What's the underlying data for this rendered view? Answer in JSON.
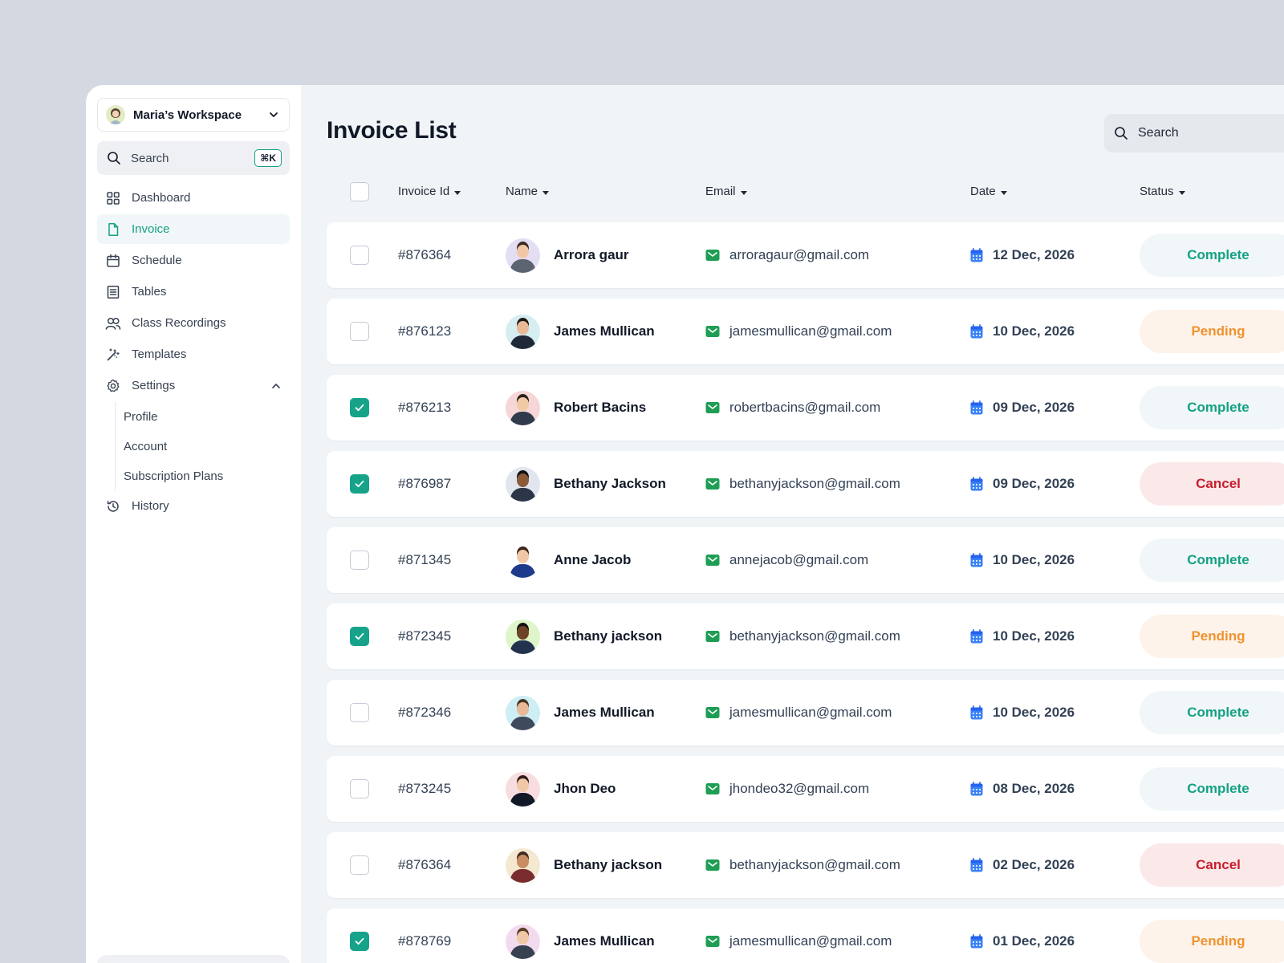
{
  "sidebar": {
    "workspace": "Maria’s Workspace",
    "search_placeholder": "Search",
    "shortcut": "⌘K",
    "items": [
      {
        "label": "Dashboard",
        "icon": "dashboard-icon",
        "active": false
      },
      {
        "label": "Invoice",
        "icon": "document-icon",
        "active": true
      },
      {
        "label": "Schedule",
        "icon": "calendar-icon",
        "active": false
      },
      {
        "label": "Tables",
        "icon": "table-icon",
        "active": false
      },
      {
        "label": "Class Recordings",
        "icon": "users-icon",
        "active": false
      },
      {
        "label": "Templates",
        "icon": "magic-wand-icon",
        "active": false
      },
      {
        "label": "Settings",
        "icon": "gear-icon",
        "active": false
      }
    ],
    "settings_sub": [
      "Profile",
      "Account",
      "Subscription Plans"
    ],
    "history": "History"
  },
  "main": {
    "title": "Invoice List",
    "search_placeholder": "Search",
    "columns": [
      "Invoice Id",
      "Name",
      "Email",
      "Date",
      "Status"
    ],
    "rows": [
      {
        "id": "#876364",
        "name": "Arrora gaur",
        "email": "arroragaur@gmail.com",
        "date": "12 Dec, 2026",
        "status": "Complete",
        "checked": false
      },
      {
        "id": "#876123",
        "name": "James Mullican",
        "email": "jamesmullican@gmail.com",
        "date": "10 Dec, 2026",
        "status": "Pending",
        "checked": false
      },
      {
        "id": "#876213",
        "name": "Robert Bacins",
        "email": "robertbacins@gmail.com",
        "date": "09 Dec, 2026",
        "status": "Complete",
        "checked": true
      },
      {
        "id": "#876987",
        "name": "Bethany Jackson",
        "email": "bethanyjackson@gmail.com",
        "date": "09 Dec, 2026",
        "status": "Cancel",
        "checked": true
      },
      {
        "id": "#871345",
        "name": "Anne Jacob",
        "email": "annejacob@gmail.com",
        "date": "10 Dec, 2026",
        "status": "Complete",
        "checked": false
      },
      {
        "id": "#872345",
        "name": "Bethany jackson",
        "email": "bethanyjackson@gmail.com",
        "date": "10 Dec, 2026",
        "status": "Pending",
        "checked": true
      },
      {
        "id": "#872346",
        "name": "James Mullican",
        "email": "jamesmullican@gmail.com",
        "date": "10 Dec, 2026",
        "status": "Complete",
        "checked": false
      },
      {
        "id": "#873245",
        "name": "Jhon Deo",
        "email": "jhondeo32@gmail.com",
        "date": "08 Dec, 2026",
        "status": "Complete",
        "checked": false
      },
      {
        "id": "#876364",
        "name": "Bethany jackson",
        "email": "bethanyjackson@gmail.com",
        "date": "02 Dec, 2026",
        "status": "Cancel",
        "checked": false
      },
      {
        "id": "#878769",
        "name": "James Mullican",
        "email": "jamesmullican@gmail.com",
        "date": "01 Dec, 2026",
        "status": "Pending",
        "checked": true
      }
    ]
  },
  "colors": {
    "accent": "#14a085",
    "complete": "#14a085",
    "pending": "#f0922f",
    "cancel": "#c81e2c",
    "avatar_bg": [
      "#e4def4",
      "#d6eef0",
      "#f6d6d6",
      "#e1e6ee",
      "#ffffff",
      "#def5c9",
      "#cdeef4",
      "#f7dde0",
      "#f4e8d0",
      "#f3dbef"
    ]
  }
}
